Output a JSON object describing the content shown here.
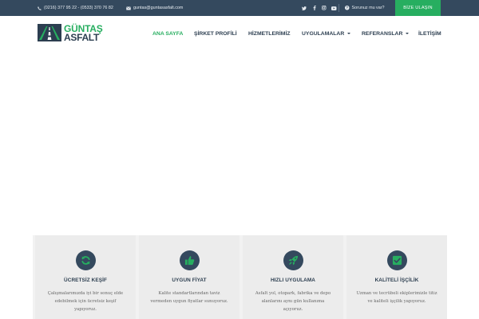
{
  "topbar": {
    "phone": "(0216) 377 95 22 - (0533) 370 76 82",
    "email": "guntas@guntasasfalt.com",
    "social": [
      "twitter-icon",
      "facebook-icon",
      "instagram-icon",
      "youtube-icon"
    ],
    "question": "Sorunuz mu var?",
    "cta": "BİZE ULAŞIN"
  },
  "header": {
    "logo_top": "GÜNTAŞ",
    "logo_bottom": "ASFALT",
    "nav": [
      {
        "label": "ANA SAYFA",
        "active": true
      },
      {
        "label": "ŞİRKET PROFİLİ"
      },
      {
        "label": "HİZMETLERİMİZ"
      },
      {
        "label": "UYGULAMALAR",
        "dropdown": true
      },
      {
        "label": "REFERANSLAR",
        "dropdown": true
      },
      {
        "label": "İLETİŞİM"
      }
    ]
  },
  "features": [
    {
      "icon": "refresh-icon",
      "title": "ÜCRETSİZ KEŞİF",
      "lines": [
        "Çalışmalarımızda iyi bir sonuç elde",
        "edebilmek için ücretsiz keşif",
        "yapıyoruz."
      ]
    },
    {
      "icon": "thumbs-up-icon",
      "title": "UYGUN FİYAT",
      "lines": [
        "Kalite standartlarından taviz",
        "vermeden uygun fiyatlar sunuyoruz."
      ]
    },
    {
      "icon": "rocket-icon",
      "title": "HIZLI UYGULAMA",
      "lines": [
        "Asfalt yol, otopark, fabrika ve depo",
        "alanlarını aynı gün kullanıma",
        "açıyoruz."
      ]
    },
    {
      "icon": "check-icon",
      "title": "KALİTELİ İŞÇİLİK",
      "lines": [
        "Uzman ve tecrübeli ekiplerimizle titiz",
        "ve kaliteli işçilik yapıyoruz."
      ]
    }
  ],
  "colors": {
    "topbar": "#34495e",
    "accent": "#27ae60",
    "navy": "#2c3e50",
    "feature_bg": "#ececec"
  }
}
